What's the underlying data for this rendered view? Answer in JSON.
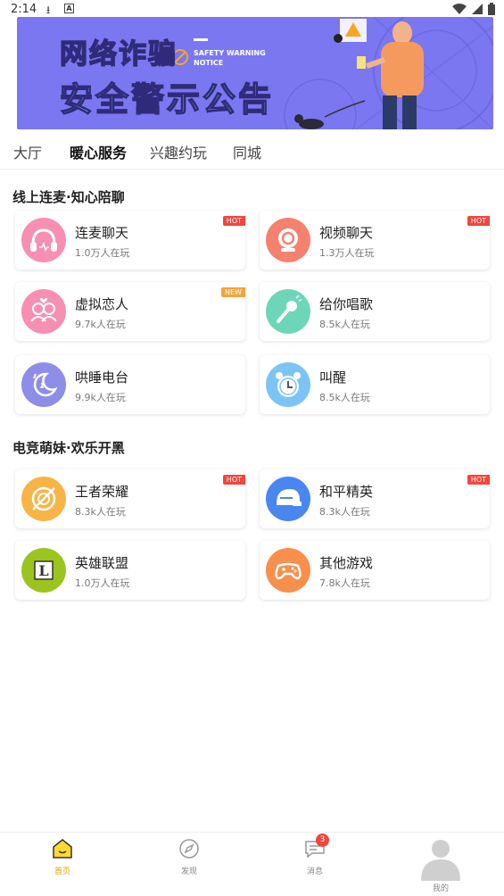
{
  "status_bar": {
    "time": "2:14"
  },
  "banner": {
    "title_line1": "网络诈骗",
    "title_line2": "安全警示公告",
    "en_text": "SAFETY WARNING NOTICE",
    "bg_color": "#7b77f0"
  },
  "tabs": [
    {
      "label": "大厅",
      "active": false
    },
    {
      "label": "暖心服务",
      "active": true
    },
    {
      "label": "兴趣约玩",
      "active": false
    },
    {
      "label": "同城",
      "active": false
    }
  ],
  "sections": [
    {
      "title": "线上连麦·知心陪聊",
      "cards": [
        {
          "name": "连麦聊天",
          "players": "1.0万人在玩",
          "badge": "HOT",
          "icon": "headphones-icon",
          "icon_color": "#f78fb3"
        },
        {
          "name": "视频聊天",
          "players": "1.3万人在玩",
          "badge": "HOT",
          "icon": "webcam-icon",
          "icon_color": "#f5826f"
        },
        {
          "name": "虚拟恋人",
          "players": "9.7k人在玩",
          "badge": "NEW",
          "icon": "couple-icon",
          "icon_color": "#f78fb3"
        },
        {
          "name": "给你唱歌",
          "players": "8.5k人在玩",
          "badge": "",
          "icon": "microphone-icon",
          "icon_color": "#6ed6b8"
        },
        {
          "name": "哄睡电台",
          "players": "9.9k人在玩",
          "badge": "",
          "icon": "moon-icon",
          "icon_color": "#8e8ee8"
        },
        {
          "name": "叫醒",
          "players": "8.5k人在玩",
          "badge": "",
          "icon": "alarm-clock-icon",
          "icon_color": "#7cc4f5"
        }
      ]
    },
    {
      "title": "电竞萌妹·欢乐开黑",
      "cards": [
        {
          "name": "王者荣耀",
          "players": "8.3k人在玩",
          "badge": "HOT",
          "icon": "honor-of-kings-icon",
          "icon_color": "#f8b446"
        },
        {
          "name": "和平精英",
          "players": "8.3k人在玩",
          "badge": "HOT",
          "icon": "helmet-icon",
          "icon_color": "#4a86f0"
        },
        {
          "name": "英雄联盟",
          "players": "1.0万人在玩",
          "badge": "",
          "icon": "league-icon",
          "icon_color": "#9cc41f"
        },
        {
          "name": "其他游戏",
          "players": "7.8k人在玩",
          "badge": "",
          "icon": "gamepad-icon",
          "icon_color": "#f88f4c"
        }
      ]
    }
  ],
  "bottom_nav": [
    {
      "label": "首页",
      "active": true,
      "icon": "home-icon"
    },
    {
      "label": "发现",
      "active": false,
      "icon": "compass-icon"
    },
    {
      "label": "消息",
      "active": false,
      "icon": "message-icon",
      "count": "3"
    },
    {
      "label": "我的",
      "active": false,
      "icon": "avatar-icon"
    }
  ],
  "colors": {
    "accent": "#ffd92f",
    "hot": "#f2453d",
    "new": "#f6a33b"
  }
}
